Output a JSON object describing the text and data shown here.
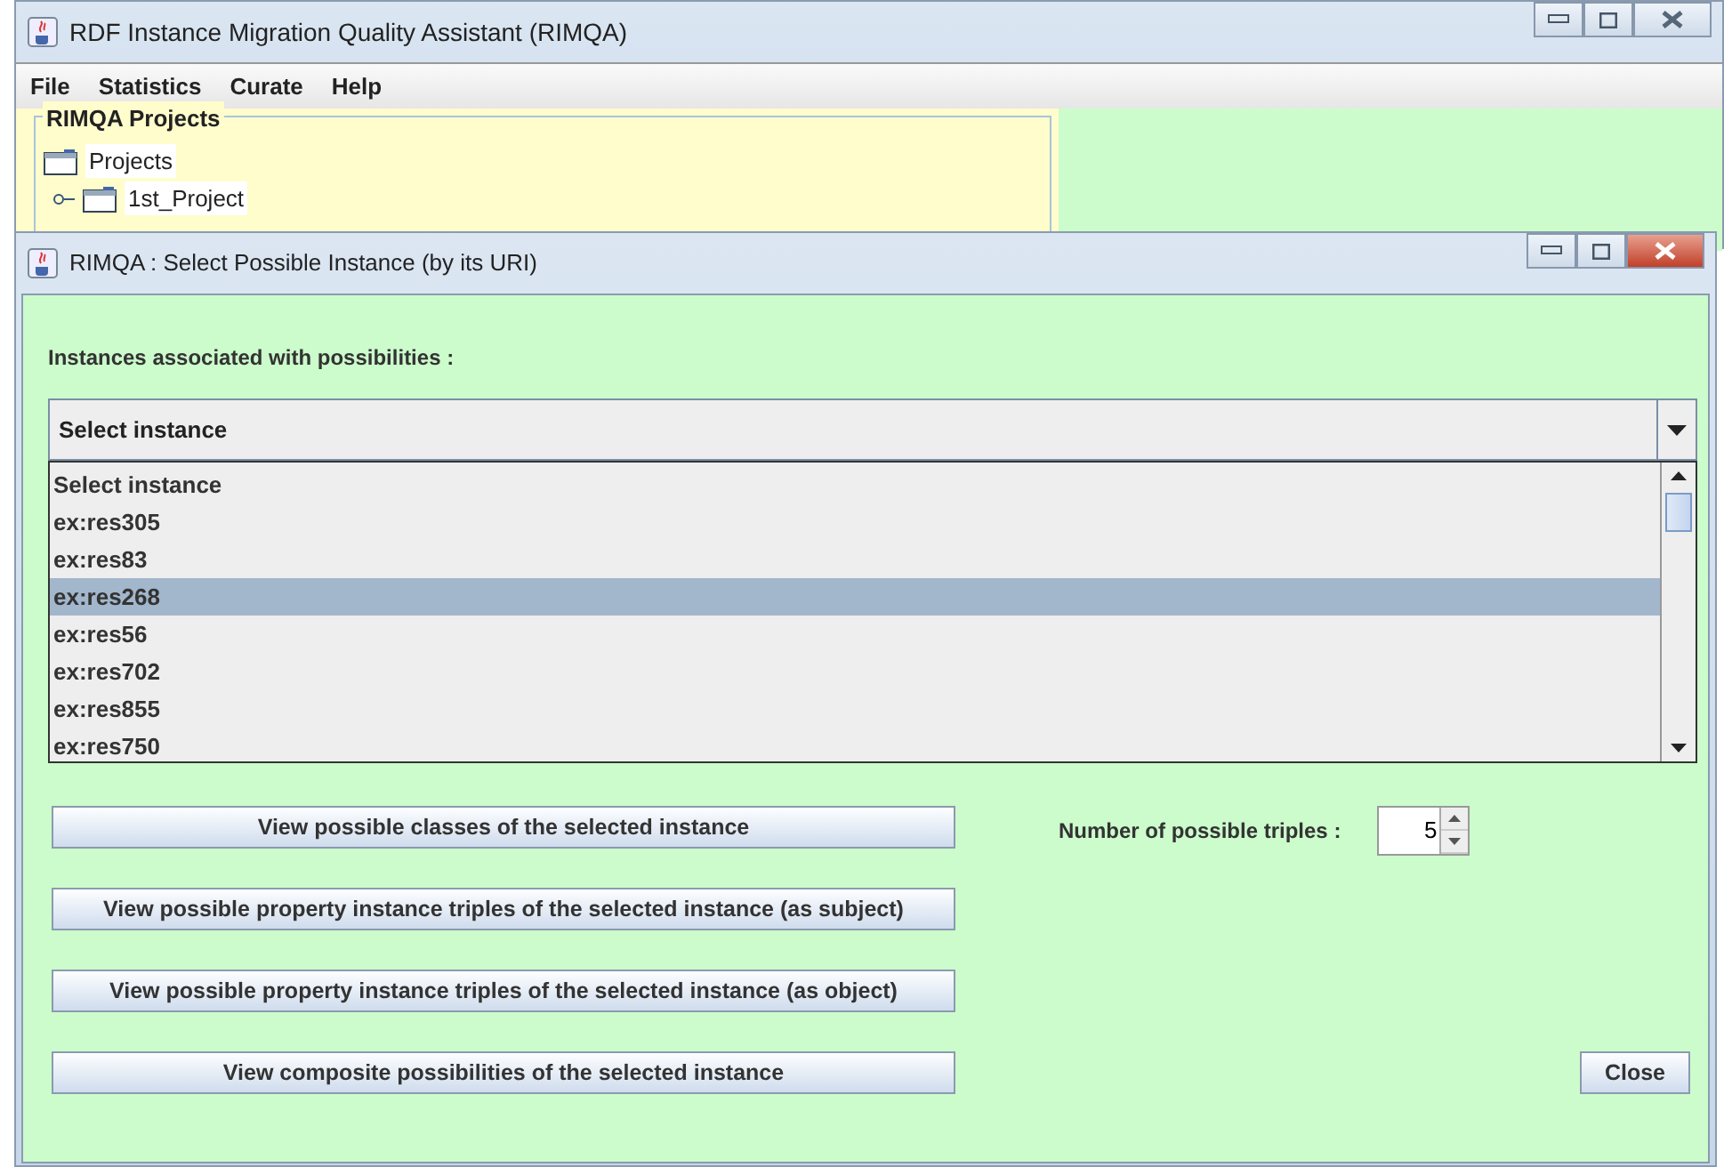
{
  "main_window": {
    "title": "RDF Instance Migration Quality Assistant (RIMQA)",
    "menu": [
      "File",
      "Statistics",
      "Curate",
      "Help"
    ],
    "projects_panel": {
      "title": "RIMQA Projects",
      "tree": [
        {
          "label": "Projects",
          "children": [
            {
              "label": "1st_Project"
            }
          ]
        }
      ]
    }
  },
  "dialog": {
    "title": "RIMQA : Select Possible Instance (by its URI)",
    "instances_label": "Instances associated with possibilities :",
    "combo": {
      "value": "Select instance",
      "expanded": true
    },
    "options": [
      {
        "label": "Select instance",
        "selected": false
      },
      {
        "label": "ex:res305",
        "selected": false
      },
      {
        "label": "ex:res83",
        "selected": false
      },
      {
        "label": "ex:res268",
        "selected": true
      },
      {
        "label": "ex:res56",
        "selected": false
      },
      {
        "label": "ex:res702",
        "selected": false
      },
      {
        "label": "ex:res855",
        "selected": false
      },
      {
        "label": "ex:res750",
        "selected": false
      }
    ],
    "buttons": [
      "View possible classes of the selected instance",
      "View possible property instance triples of the selected instance (as subject)",
      "View possible property instance triples of the selected instance (as object)",
      "View composite possibilities of the selected instance"
    ],
    "triples_label": "Number of possible triples :",
    "triples_value": "5",
    "close_button": "Close"
  }
}
